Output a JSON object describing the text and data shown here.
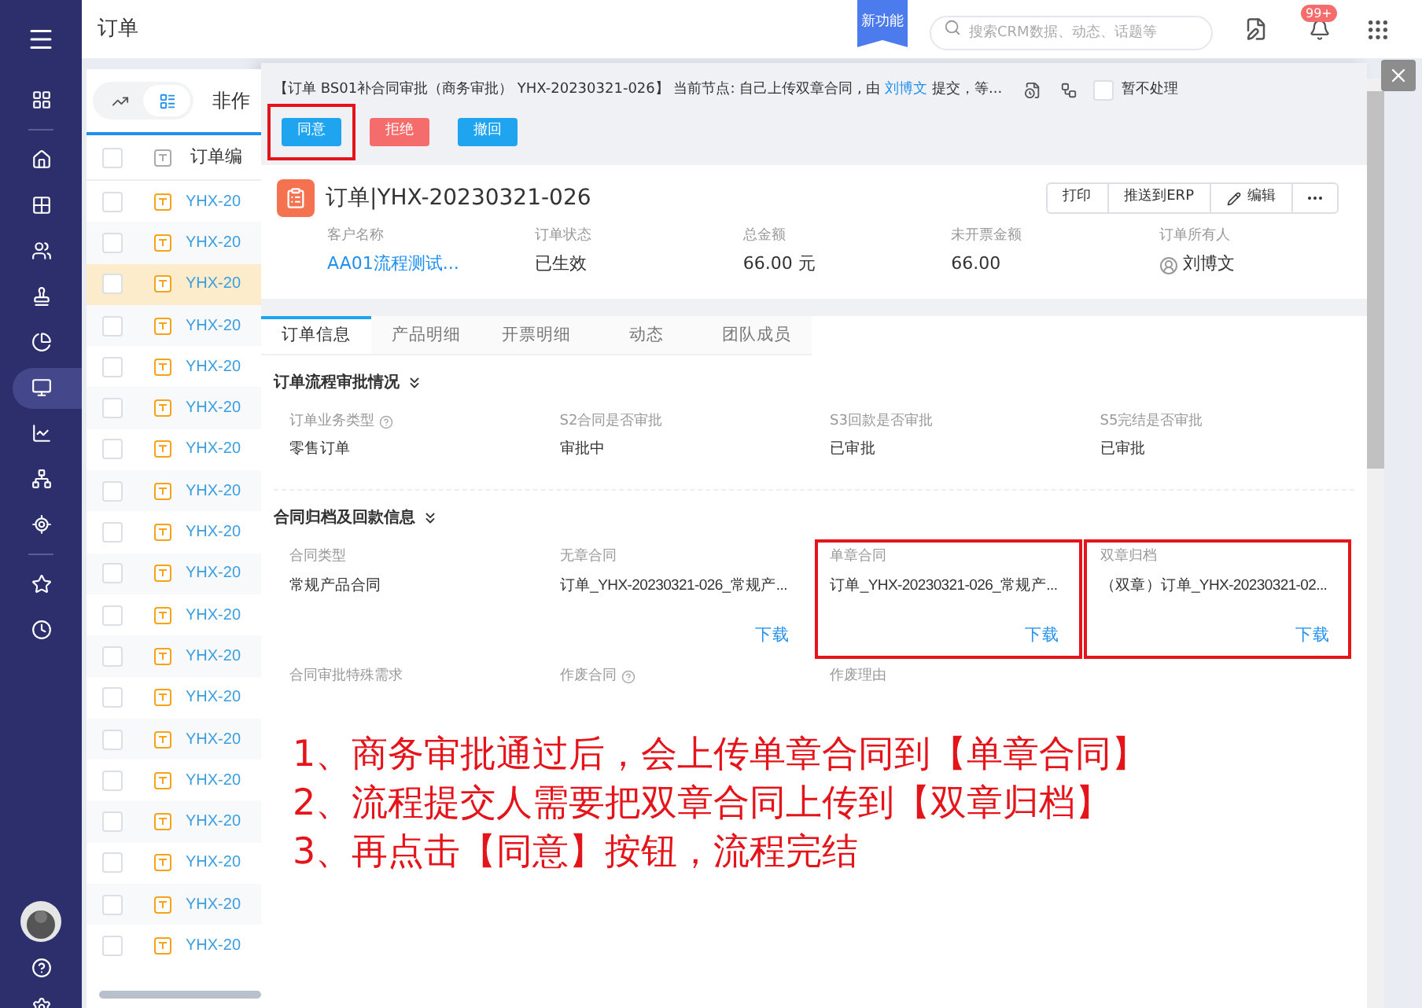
{
  "header": {
    "title": "订单",
    "new_badge": "新功能",
    "search": {
      "placeholder": "搜索CRM数据、动态、话题等"
    },
    "notification_count": "99+"
  },
  "sidebar": {
    "items": [
      {
        "selected": false
      },
      {
        "selected": false
      },
      {
        "selected": false
      },
      {
        "selected": false
      },
      {
        "selected": false
      },
      {
        "selected": false
      },
      {
        "selected": true
      },
      {
        "selected": false
      },
      {
        "selected": false
      },
      {
        "selected": false
      },
      {
        "selected": false
      },
      {
        "selected": false
      }
    ]
  },
  "list": {
    "all_checked": false,
    "views": [
      {
        "selected": false
      },
      {
        "selected": true
      }
    ],
    "filter": "非作",
    "column": "订单编",
    "rows": [
      {
        "code": "YHX-20",
        "checked": false,
        "selected": false
      },
      {
        "code": "YHX-20",
        "checked": false,
        "selected": false
      },
      {
        "code": "YHX-20",
        "checked": false,
        "selected": true
      },
      {
        "code": "YHX-20",
        "checked": false,
        "selected": false
      },
      {
        "code": "YHX-20",
        "checked": false,
        "selected": false
      },
      {
        "code": "YHX-20",
        "checked": false,
        "selected": false
      },
      {
        "code": "YHX-20",
        "checked": false,
        "selected": false
      },
      {
        "code": "YHX-20",
        "checked": false,
        "selected": false
      },
      {
        "code": "YHX-20",
        "checked": false,
        "selected": false
      },
      {
        "code": "YHX-20",
        "checked": false,
        "selected": false
      },
      {
        "code": "YHX-20",
        "checked": false,
        "selected": false
      },
      {
        "code": "YHX-20",
        "checked": false,
        "selected": false
      },
      {
        "code": "YHX-20",
        "checked": false,
        "selected": false
      },
      {
        "code": "YHX-20",
        "checked": false,
        "selected": false
      },
      {
        "code": "YHX-20",
        "checked": false,
        "selected": false
      },
      {
        "code": "YHX-20",
        "checked": false,
        "selected": false
      },
      {
        "code": "YHX-20",
        "checked": false,
        "selected": false
      },
      {
        "code": "YHX-20",
        "checked": false,
        "selected": false
      },
      {
        "code": "YHX-20",
        "checked": false,
        "selected": false
      }
    ]
  },
  "approval": {
    "prefix": "【订单 BS01补合同审批（商务审批） YHX-20230321-026】 当前节点: 自己上传双章合同 , 由",
    "submitter": "刘博文",
    "suffix": "提交，等...",
    "hold": {
      "label": "暂不处理",
      "checked": false
    },
    "actions": [
      {
        "label": "同意",
        "kind": "approve",
        "highlighted": true
      },
      {
        "label": "拒绝",
        "kind": "reject",
        "highlighted": false
      },
      {
        "label": "撤回",
        "kind": "withdraw",
        "highlighted": false
      }
    ]
  },
  "record": {
    "title": "订单|YHX-20230321-026",
    "actions": [
      {
        "label": "打印",
        "kind": "text"
      },
      {
        "label": "推送到ERP",
        "kind": "text"
      },
      {
        "label": "编辑",
        "kind": "edit"
      },
      {
        "kind": "more"
      }
    ],
    "fields": [
      {
        "label": "客户名称",
        "value": "AA01流程测试...",
        "kind": "link"
      },
      {
        "label": "订单状态",
        "value": "已生效",
        "kind": "text"
      },
      {
        "label": "总金额",
        "value": "66.00 元",
        "kind": "text"
      },
      {
        "label": "未开票金额",
        "value": "66.00",
        "kind": "text"
      },
      {
        "label": "订单所有人",
        "value": "刘博文",
        "kind": "user"
      }
    ]
  },
  "tabs": [
    {
      "label": "订单信息",
      "selected": true
    },
    {
      "label": "产品明细",
      "selected": false
    },
    {
      "label": "开票明细",
      "selected": false
    },
    {
      "label": "动态",
      "selected": false
    },
    {
      "label": "团队成员",
      "selected": false
    }
  ],
  "sections": [
    {
      "title": "订单流程审批情况",
      "expanded": true,
      "fields": [
        {
          "label": "订单业务类型",
          "help": true,
          "value": "零售订单"
        },
        {
          "label": "S2合同是否审批",
          "value": "审批中"
        },
        {
          "label": "S3回款是否审批",
          "value": "已审批"
        },
        {
          "label": "S5完结是否审批",
          "value": "已审批"
        }
      ]
    },
    {
      "title": "合同归档及回款信息",
      "expanded": true,
      "fields": [
        {
          "label": "合同类型",
          "value": "常规产品合同"
        },
        {
          "label": "无章合同",
          "value": "订单_YHX-20230321-026_常规产...",
          "download": "下载"
        },
        {
          "label": "单章合同",
          "value": "订单_YHX-20230321-026_常规产...",
          "download": "下载",
          "highlighted": true
        },
        {
          "label": "双章归档",
          "value": "（双章）订单_YHX-20230321-02...",
          "download": "下载",
          "highlighted": true
        },
        {
          "label": "合同审批特殊需求"
        },
        {
          "label": "作废合同",
          "help": true
        },
        {
          "label": "作废理由"
        }
      ]
    }
  ],
  "annotation": {
    "lines": [
      "1、商务审批通过后，会上传单章合同到【单章合同】",
      "2、流程提交人需要把双章合同上传到【双章归档】",
      "3、再点击【同意】按钮，流程完结"
    ]
  }
}
